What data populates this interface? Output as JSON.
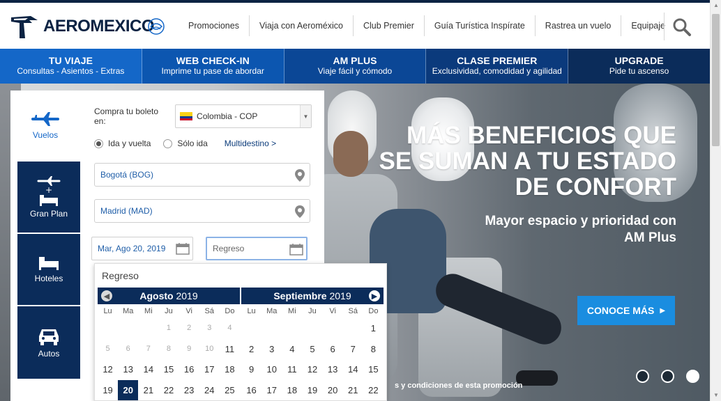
{
  "header": {
    "logo_text": "AEROMEXICO",
    "nav": [
      "Promociones",
      "Viaja con Aeroméxico",
      "Club Premier",
      "Guía Turística Inspírate",
      "Rastrea un vuelo",
      "Equipaje"
    ]
  },
  "bluebar": [
    {
      "title": "TU VIAJE",
      "sub": "Consultas - Asientos - Extras",
      "color": "#1467c8"
    },
    {
      "title": "WEB CHECK-IN",
      "sub": "Imprime tu pase de abordar",
      "color": "#0c56b0"
    },
    {
      "title": "AM PLUS",
      "sub": "Viaje fácil y cómodo",
      "color": "#0b4796"
    },
    {
      "title": "CLASE PREMIER",
      "sub": "Exclusividad, comodidad y agilidad",
      "color": "#0b3a7c"
    },
    {
      "title": "UPGRADE",
      "sub": "Pide tu ascenso",
      "color": "#0b2c5a"
    }
  ],
  "tabs": {
    "vuelos": "Vuelos",
    "gran_plan": "Gran Plan",
    "hoteles": "Hoteles",
    "autos": "Autos"
  },
  "form": {
    "country_label": "Compra tu boleto en:",
    "country_value": "Colombia - COP",
    "trip_round": "Ida y vuelta",
    "trip_oneway": "Sólo ida",
    "multidestino": "Multidestino >",
    "origin": "Bogotá (BOG)",
    "destination": "Madrid (MAD)",
    "depart_date": "Mar, Ago 20, 2019",
    "return_placeholder": "Regreso"
  },
  "calendar": {
    "title": "Regreso",
    "weekdays": [
      "Lu",
      "Ma",
      "Mi",
      "Ju",
      "Vi",
      "Sá",
      "Do"
    ],
    "months": [
      {
        "name": "Agosto",
        "year": "2019"
      },
      {
        "name": "Septiembre",
        "year": "2019"
      }
    ],
    "selected_day": "20"
  },
  "hero": {
    "title": "MÁS BENEFICIOS QUE SE SUMAN A TU ESTADO DE CONFORT",
    "subtitle": "Mayor espacio y prioridad con AM Plus",
    "cta": "CONOCE MÁS",
    "terms": "s y condiciones de esta promoción"
  }
}
